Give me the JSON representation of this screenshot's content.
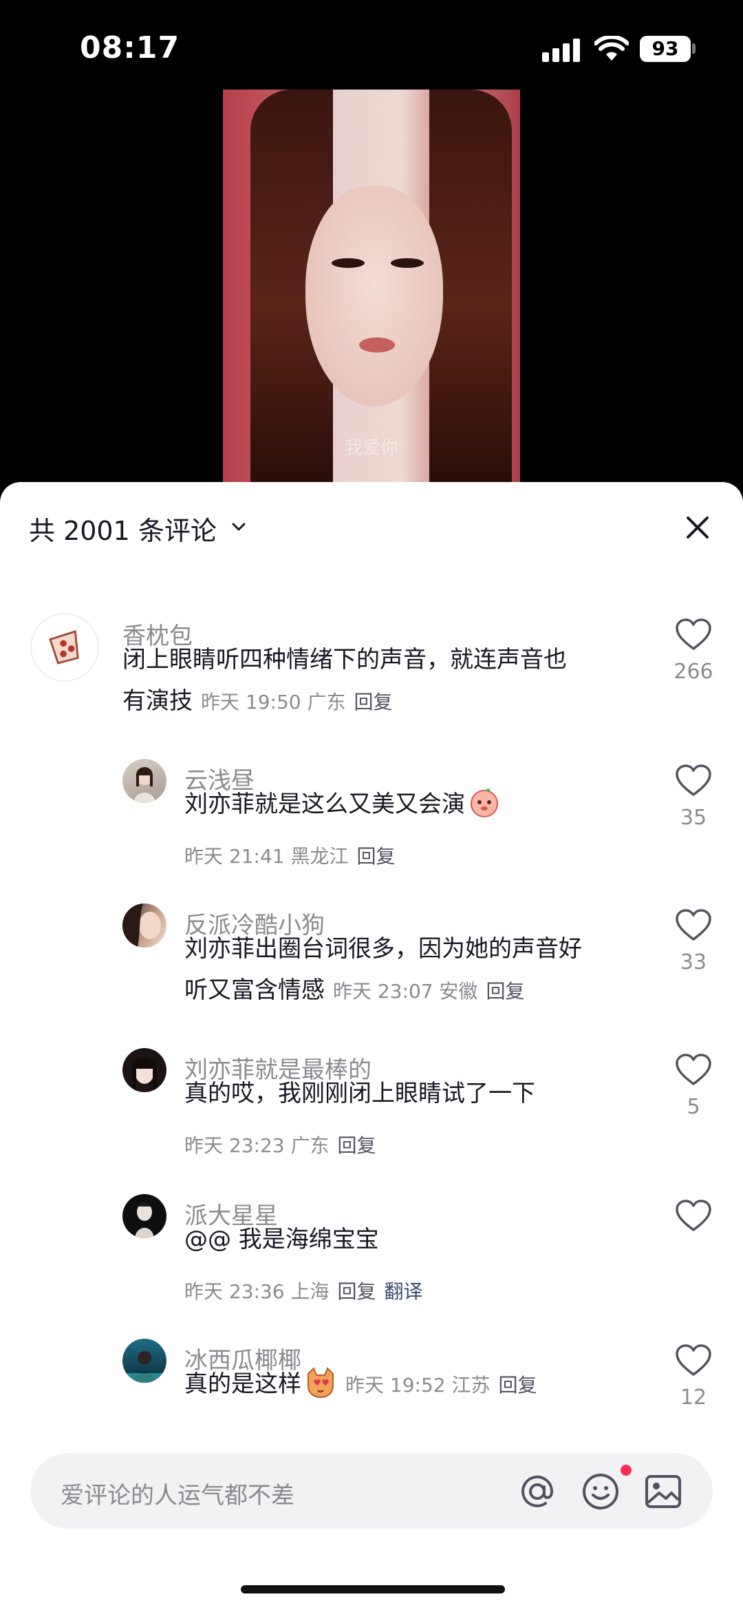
{
  "status_bar": {
    "time": "08:17",
    "battery": "93"
  },
  "video": {
    "caption": "我爱你"
  },
  "comments_sheet": {
    "title": "共 2001 条评论",
    "input_placeholder": "爱评论的人运气都不差",
    "comments": [
      {
        "nickname": "香枕包",
        "text_line1": "闭上眼睛听四种情绪下的声音，就连声音也",
        "text_line2": "有演技",
        "time": "昨天 19:50",
        "location": "广东",
        "reply": "回复",
        "likes": "266"
      },
      {
        "nickname": "云浅昼",
        "text": "刘亦菲就是这么又美又会演",
        "time": "昨天 21:41",
        "location": "黑龙江",
        "reply": "回复",
        "likes": "35"
      },
      {
        "nickname": "反派冷酷小狗",
        "text_line1": "刘亦菲出圈台词很多，因为她的声音好",
        "text_line2": "听又富含情感",
        "time": "昨天 23:07",
        "location": "安徽",
        "reply": "回复",
        "likes": "33"
      },
      {
        "nickname": "刘亦菲就是最棒的",
        "text": "真的哎，我刚刚闭上眼睛试了一下",
        "time": "昨天 23:23",
        "location": "广东",
        "reply": "回复",
        "likes": "5"
      },
      {
        "nickname": "派大星星",
        "text": "@@ 我是海绵宝宝",
        "time": "昨天 23:36",
        "location": "上海",
        "reply": "回复",
        "translate": "翻译",
        "likes": ""
      },
      {
        "nickname": "冰西瓜椰椰",
        "text": "真的是这样",
        "time": "昨天 19:52",
        "location": "江苏",
        "reply": "回复",
        "likes": "12"
      }
    ]
  },
  "colors": {
    "accent_red": "#fe2c55",
    "text_primary": "#161823",
    "text_secondary": "#8a8b91"
  }
}
